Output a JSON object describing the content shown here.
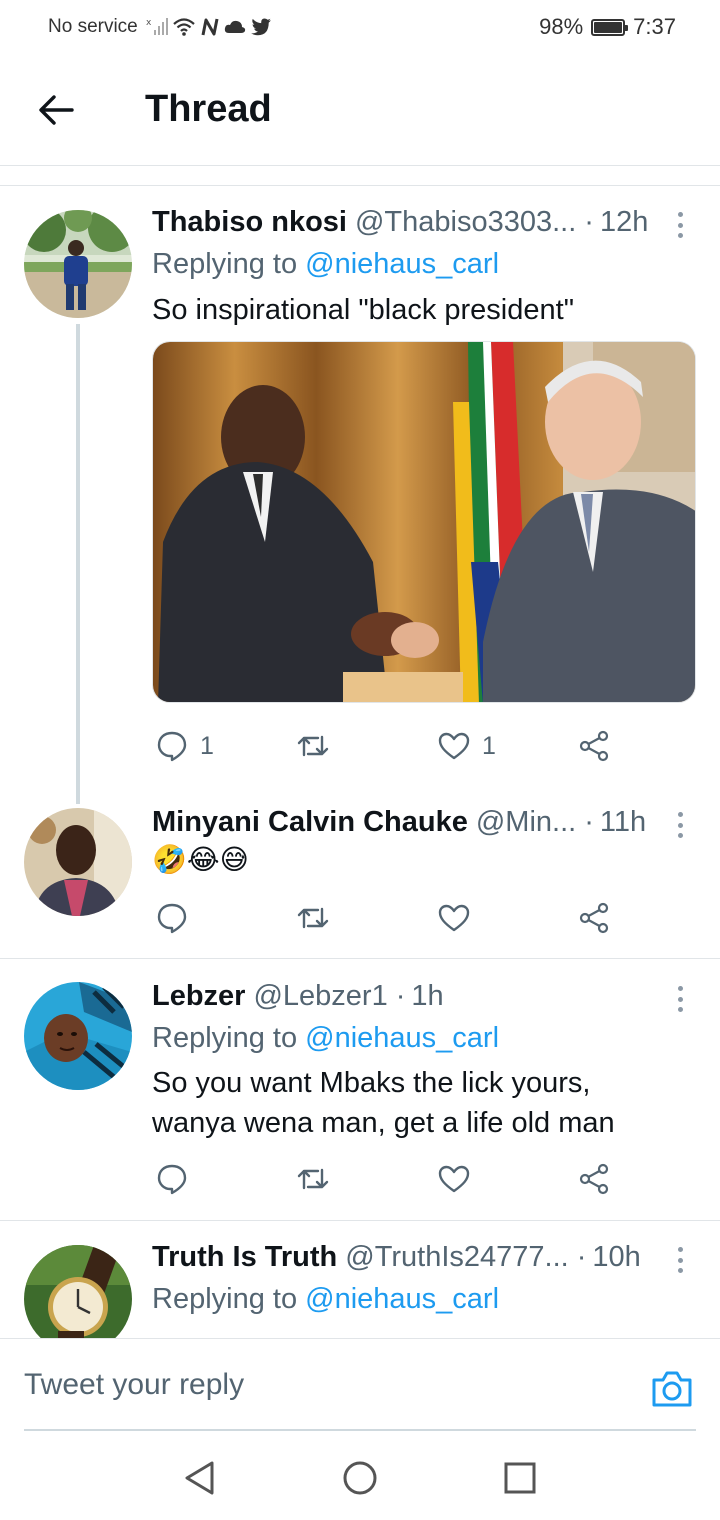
{
  "status_bar": {
    "carrier": "No service",
    "battery": "98%",
    "battery_level": 0.98,
    "time": "7:37",
    "icons": [
      "no-signal-icon",
      "wifi-icon",
      "nfc-icon",
      "cloud-icon",
      "twitter-bird-icon"
    ]
  },
  "header": {
    "title": "Thread",
    "back_icon": "arrow-left-icon"
  },
  "tweets": [
    {
      "name": "Thabiso nkosi",
      "handle": "@Thabiso3303...",
      "time": "12h",
      "replying_prefix": "Replying to",
      "replying_to": "@niehaus_carl",
      "text": "So inspirational \"black president\"",
      "has_media": true,
      "reply_count": "1",
      "retweet_count": "",
      "like_count": "1"
    },
    {
      "name": "Minyani Calvin Chauke",
      "handle": "@Min...",
      "time": "11h",
      "text": "🤣😂😅",
      "reply_count": "",
      "retweet_count": "",
      "like_count": ""
    },
    {
      "name": "Lebzer",
      "handle": "@Lebzer1",
      "time": "1h",
      "replying_prefix": "Replying to",
      "replying_to": "@niehaus_carl",
      "text": "So you want Mbaks the lick yours, wanya wena man, get a life old man",
      "reply_count": "",
      "retweet_count": "",
      "like_count": ""
    },
    {
      "name": "Truth Is Truth",
      "handle": "@TruthIs24777...",
      "time": "10h",
      "replying_prefix": "Replying to",
      "replying_to": "@niehaus_carl"
    }
  ],
  "composer": {
    "placeholder": "Tweet your reply",
    "camera_icon": "camera-icon"
  },
  "nav_bar": {
    "icons": [
      "back-triangle-icon",
      "home-circle-icon",
      "recents-square-icon"
    ]
  },
  "colors": {
    "accent": "#1d9bf0",
    "text": "#0f1419",
    "secondary": "#536471",
    "divider": "#e1e5e8"
  }
}
